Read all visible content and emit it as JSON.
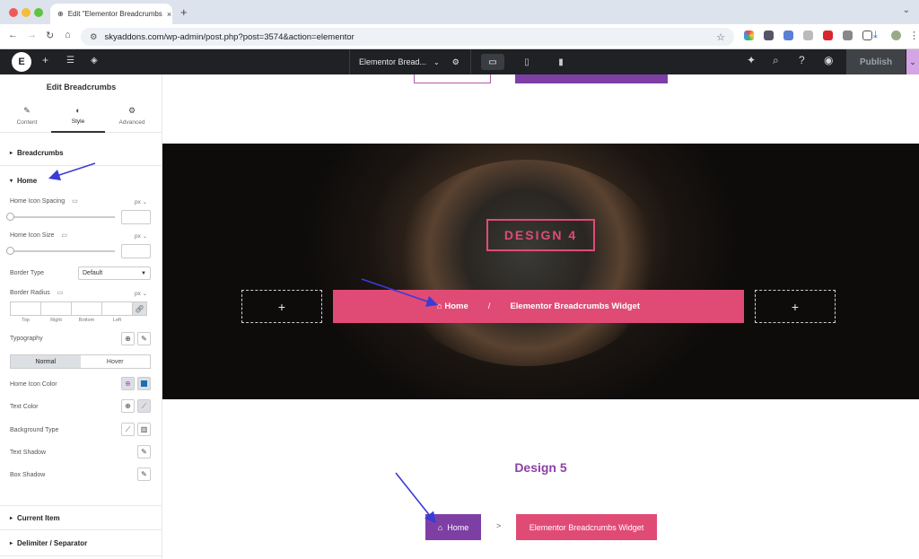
{
  "browser": {
    "tab_title": "Edit \"Elementor Breadcrumbs",
    "tab_close": "×",
    "new_tab": "+",
    "url": "skyaddons.com/wp-admin/post.php?post=3574&action=elementor"
  },
  "editor": {
    "logo": "E",
    "document_title": "Elementor Bread...",
    "publish_label": "Publish"
  },
  "panel": {
    "title": "Edit Breadcrumbs",
    "tabs": [
      {
        "label": "Content",
        "icon": "pencil-icon"
      },
      {
        "label": "Style",
        "icon": "half-circle-icon"
      },
      {
        "label": "Advanced",
        "icon": "gear-icon"
      }
    ],
    "sections": {
      "breadcrumbs": "Breadcrumbs",
      "home": "Home",
      "current_item": "Current Item",
      "delimiter": "Delimiter / Separator"
    },
    "controls": {
      "home_icon_spacing": "Home Icon Spacing",
      "home_icon_size": "Home Icon Size",
      "unit": "px",
      "border_type": "Border Type",
      "border_type_value": "Default",
      "border_radius": "Border Radius",
      "dims": [
        "Top",
        "Right",
        "Bottom",
        "Left"
      ],
      "typography": "Typography",
      "normal": "Normal",
      "hover": "Hover",
      "home_icon_color": "Home Icon Color",
      "text_color": "Text Color",
      "background_type": "Background Type",
      "text_shadow": "Text Shadow",
      "box_shadow": "Box Shadow"
    },
    "colors": {
      "home_icon_swatch": "#1a6fb5",
      "accent": "#e04b76"
    }
  },
  "canvas": {
    "design4": {
      "heading": "DESIGN 4",
      "add": "+",
      "home": "Home",
      "separator": "/",
      "current": "Elementor Breadcrumbs Widget"
    },
    "design5": {
      "heading": "Design 5",
      "home": "Home",
      "separator": ">",
      "current": "Elementor Breadcrumbs Widget"
    }
  }
}
